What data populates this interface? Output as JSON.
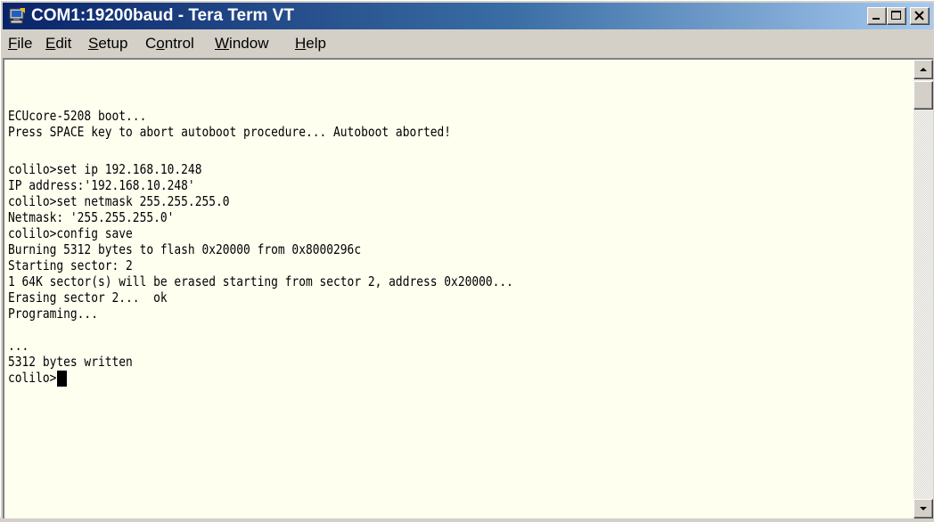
{
  "window": {
    "title": "COM1:19200baud - Tera Term VT",
    "icon": "tera-term-app-icon",
    "controls": [
      "minimize-icon",
      "maximize-icon",
      "close-icon"
    ]
  },
  "menu": [
    {
      "label": "File",
      "key": "F",
      "rest": "ile"
    },
    {
      "label": "Edit",
      "key": "E",
      "rest": "dit"
    },
    {
      "label": "Setup",
      "key": "S",
      "rest": "etup"
    },
    {
      "label": "Control",
      "key": "o",
      "pre": "C",
      "rest": "ntrol"
    },
    {
      "label": "Window",
      "key": "W",
      "rest": "indow"
    },
    {
      "label": "Help",
      "key": "H",
      "rest": "elp"
    }
  ],
  "terminal": {
    "lines": [
      "ECUcore-5208 boot...",
      "Press SPACE key to abort autoboot procedure... Autoboot aborted!",
      "",
      "colilo>set ip 192.168.10.248",
      "IP address:'192.168.10.248'",
      "colilo>set netmask 255.255.255.0",
      "Netmask: '255.255.255.0'",
      "colilo>config save",
      "Burning 5312 bytes to flash 0x20000 from 0x8000296c",
      "Starting sector: 2",
      "1 64K sector(s) will be erased starting from sector 2, address 0x20000...",
      "Erasing sector 2...  ok",
      "Programing...",
      "",
      "...",
      "5312 bytes written",
      "colilo>"
    ],
    "background": "#fffff0",
    "foreground": "#000000"
  },
  "colors": {
    "titlebar_start": "#0a246a",
    "titlebar_end": "#a6caf0",
    "chrome": "#d4d0c8"
  }
}
